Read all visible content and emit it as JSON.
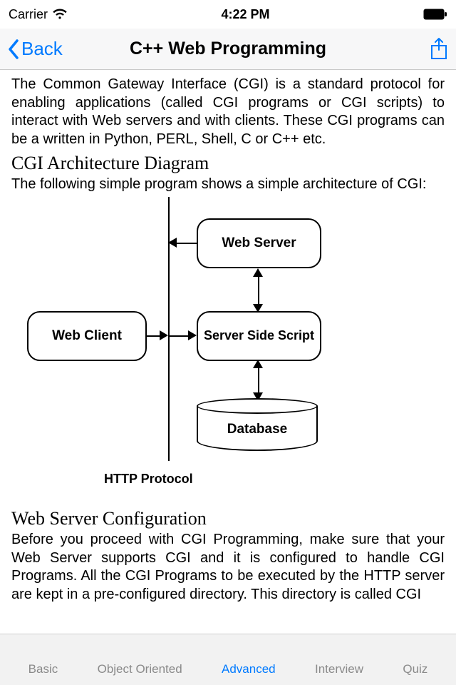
{
  "status": {
    "carrier": "Carrier",
    "time": "4:22 PM"
  },
  "nav": {
    "back": "Back",
    "title": "C++ Web Programming"
  },
  "content": {
    "intro": "The Common Gateway Interface (CGI) is a standard protocol for enabling applications (called CGI programs or CGI scripts) to interact with Web servers and with clients. These CGI programs can be a written in Python, PERL, Shell, C or C++ etc.",
    "arch_heading": "CGI Architecture Diagram",
    "arch_text": "The following simple program shows a simple architecture of CGI:",
    "config_heading": "Web Server Configuration",
    "config_text": "Before you proceed with CGI Programming, make sure that your Web Server supports CGI and it is configured to handle CGI Programs. All the CGI Programs to be executed by the HTTP server are kept in a pre-configured directory. This directory is called CGI"
  },
  "diagram": {
    "nodes": {
      "web_server": "Web Server",
      "web_client": "Web Client",
      "server_script": "Server Side Script",
      "database": "Database"
    },
    "protocol_label": "HTTP Protocol"
  },
  "tabs": {
    "items": [
      "Basic",
      "Object Oriented",
      "Advanced",
      "Interview",
      "Quiz"
    ],
    "active_index": 2
  }
}
